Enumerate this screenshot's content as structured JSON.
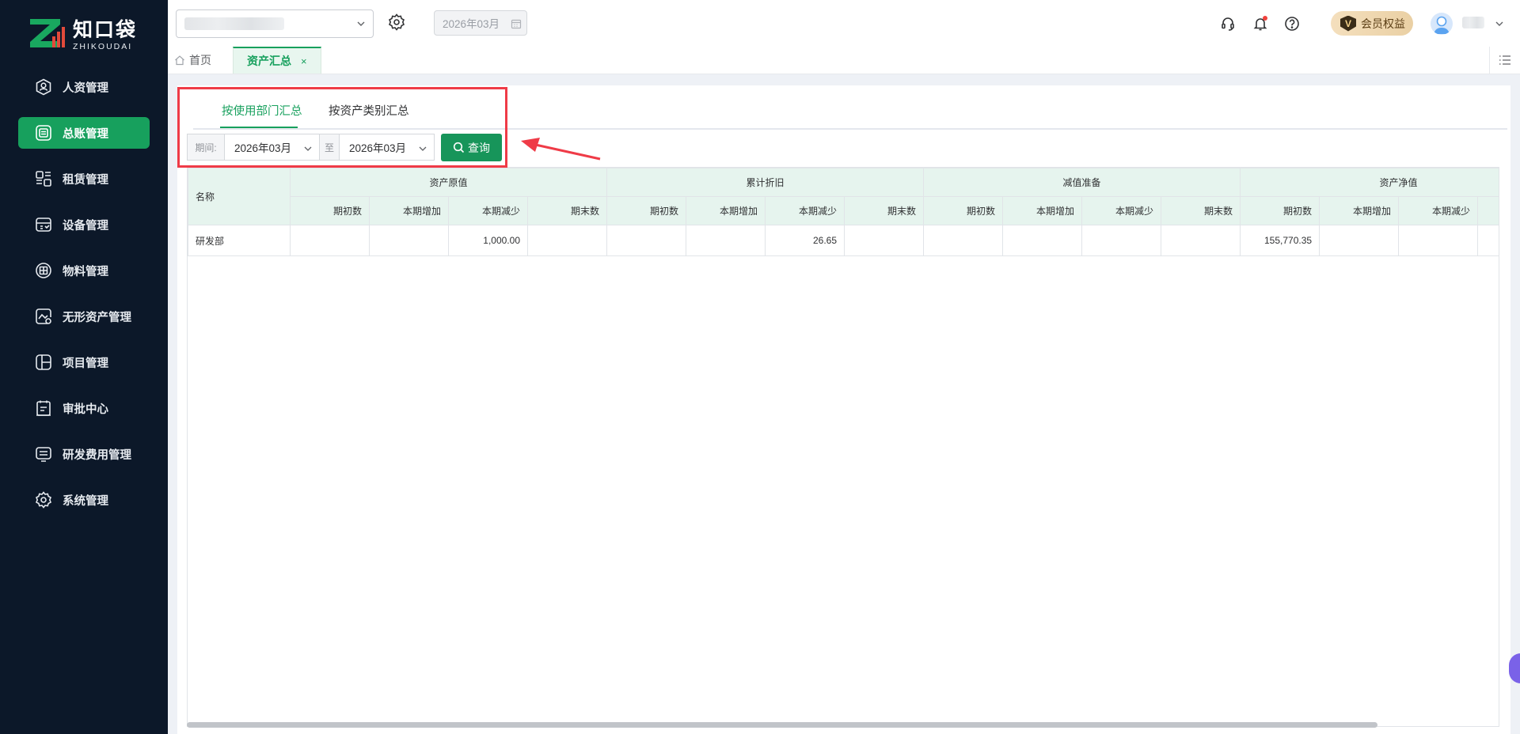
{
  "app": {
    "logo_cn": "知口袋",
    "logo_en": "ZHIKOUDAI"
  },
  "sidebar": {
    "items": [
      {
        "label": "人资管理",
        "icon": "person-icon"
      },
      {
        "label": "总账管理",
        "icon": "ledger-icon",
        "active": true
      },
      {
        "label": "租赁管理",
        "icon": "lease-icon"
      },
      {
        "label": "设备管理",
        "icon": "device-icon"
      },
      {
        "label": "物料管理",
        "icon": "material-icon"
      },
      {
        "label": "无形资产管理",
        "icon": "intangible-icon"
      },
      {
        "label": "项目管理",
        "icon": "project-icon"
      },
      {
        "label": "审批中心",
        "icon": "approval-icon"
      },
      {
        "label": "研发费用管理",
        "icon": "rd-icon"
      },
      {
        "label": "系统管理",
        "icon": "settings-icon"
      }
    ]
  },
  "topbar": {
    "period": "2026年03月",
    "member_label": "会员权益",
    "member_badge": "V"
  },
  "tabs": {
    "home": "首页",
    "active": "资产汇总",
    "close": "×"
  },
  "subtabs": [
    "按使用部门汇总",
    "按资产类别汇总"
  ],
  "filter": {
    "label": "期间:",
    "start": "2026年03月",
    "sep": "至",
    "end": "2026年03月",
    "query": "查询"
  },
  "table": {
    "name_header": "名称",
    "groups": [
      "资产原值",
      "累计折旧",
      "减值准备",
      "资产净值"
    ],
    "subcols": [
      "期初数",
      "本期增加",
      "本期减少",
      "期末数"
    ],
    "rows": [
      {
        "name": "研发部",
        "cells": [
          "",
          "",
          "1,000.00",
          "",
          "",
          "",
          "26.65",
          "",
          "",
          "",
          "",
          "",
          "155,770.35",
          "",
          "",
          ""
        ]
      }
    ]
  },
  "colors": {
    "sidebar_bg": "#0c1829",
    "accent": "#17a05d",
    "header_bg": "#e6f4ee",
    "highlight": "#ef3b47"
  }
}
